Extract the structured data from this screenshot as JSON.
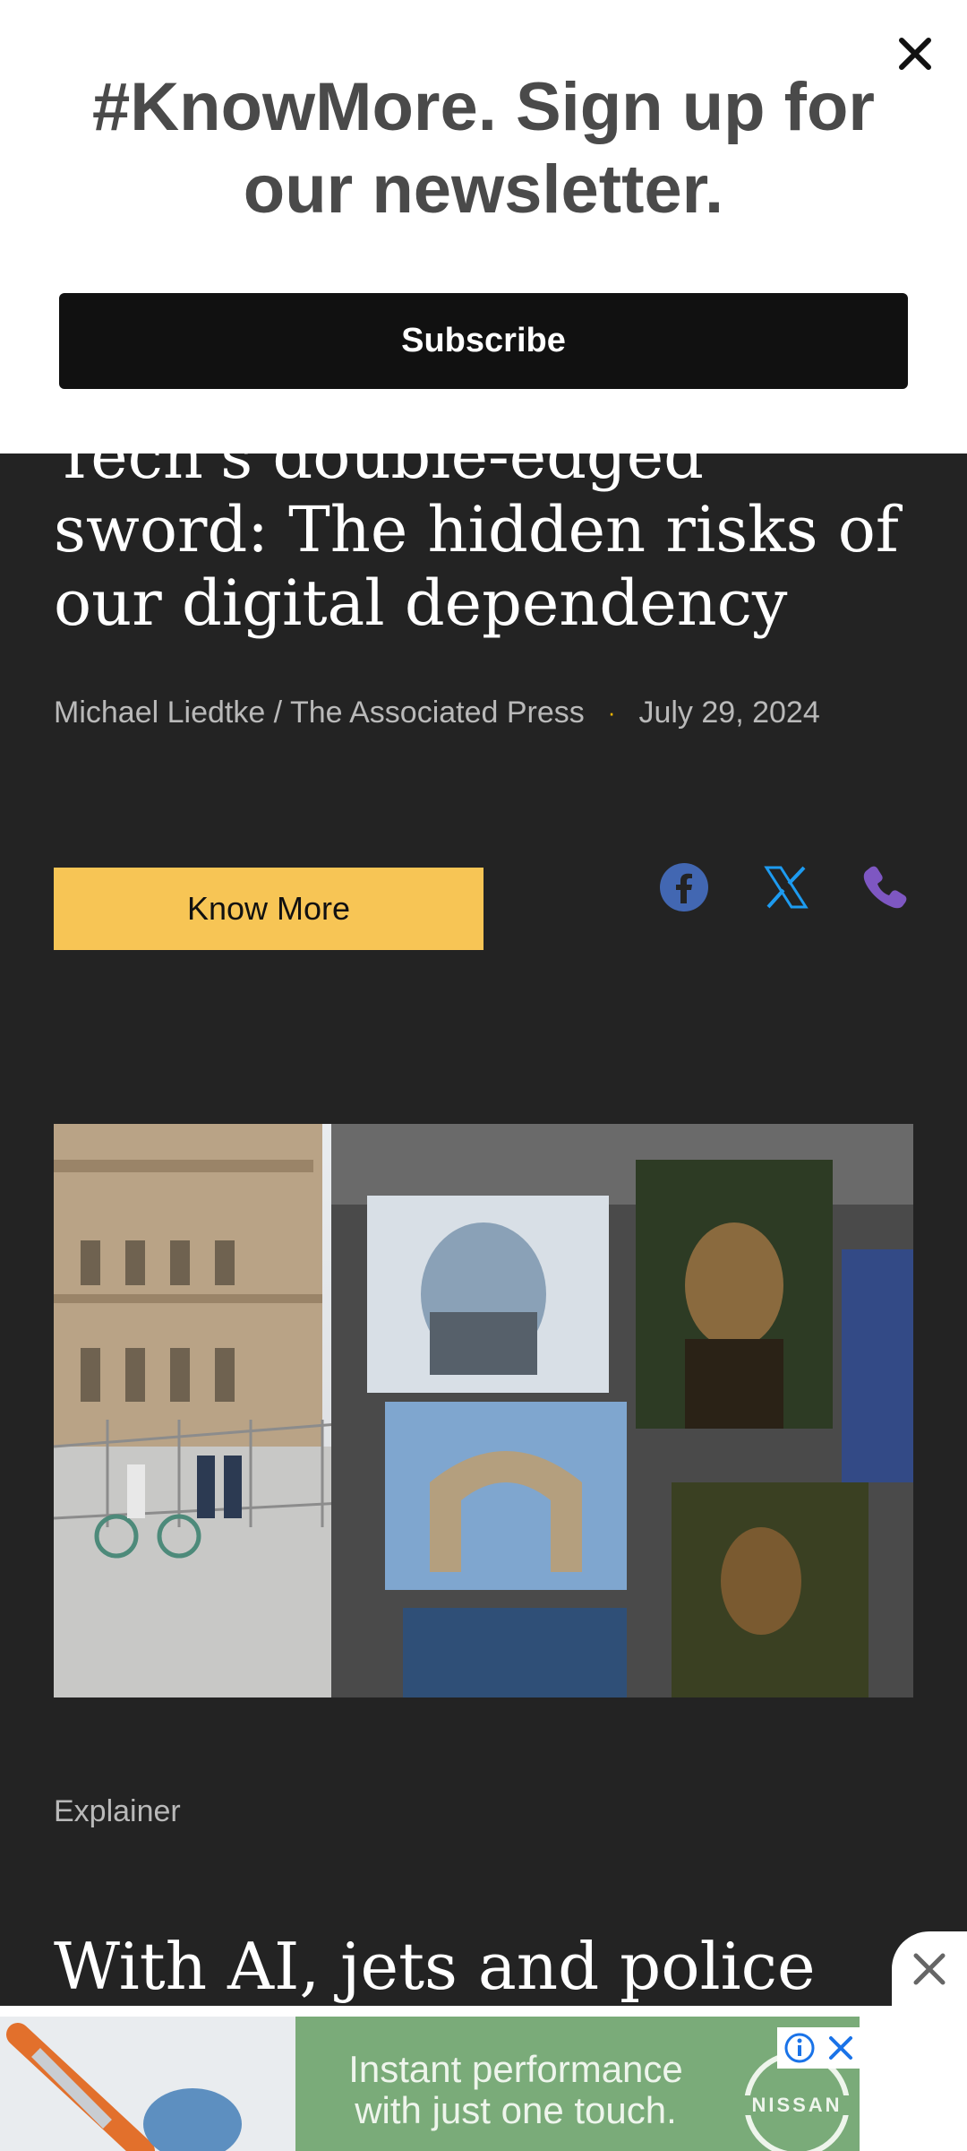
{
  "article": {
    "headline": "Tech's double-edged sword: The hidden risks of our digital dependency",
    "author": "Michael Liedtke / The Associated Press",
    "separator": "·",
    "date": "July 29, 2024",
    "know_more_label": "Know More",
    "share_icons": [
      "facebook-icon",
      "x-icon",
      "phone-icon"
    ],
    "kicker": "Explainer",
    "next_headline": "With AI, jets and police"
  },
  "newsletter_modal": {
    "title": "#KnowMore. Sign up for our newsletter.",
    "subscribe_label": "Subscribe",
    "close_icon": "close-icon"
  },
  "ad": {
    "text": "Instant performance with just one touch.",
    "brand": "NISSAN",
    "colors": {
      "background": "#7aab79",
      "badge_icon": "#1a73e8"
    }
  },
  "colors": {
    "page_background": "#232323",
    "accent_button": "#f7c555",
    "facebook": "#4267b2",
    "x": "#1d9bf0",
    "phone": "#7e57c2"
  }
}
